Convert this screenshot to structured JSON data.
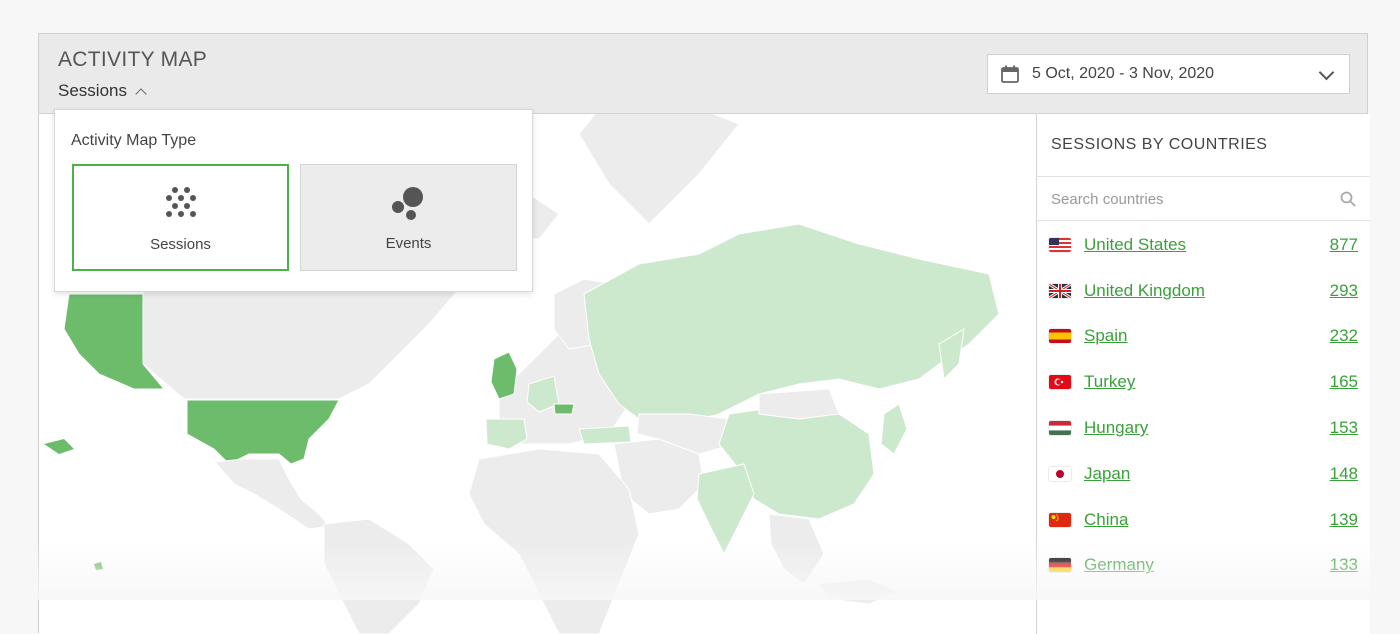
{
  "header": {
    "title": "ACTIVITY MAP",
    "mode_label": "Sessions",
    "date_range": "5 Oct, 2020 - 3 Nov, 2020"
  },
  "popup": {
    "title": "Activity Map Type",
    "options": [
      {
        "label": "Sessions",
        "selected": true,
        "icon": "dots-grid-icon"
      },
      {
        "label": "Events",
        "selected": false,
        "icon": "bubbles-icon"
      }
    ]
  },
  "sidebar": {
    "title": "SESSIONS BY COUNTRIES",
    "search_placeholder": "Search countries",
    "countries": [
      {
        "name": "United States",
        "value": "877",
        "flag": "us-flag-icon"
      },
      {
        "name": "United Kingdom",
        "value": "293",
        "flag": "uk-flag-icon"
      },
      {
        "name": "Spain",
        "value": "232",
        "flag": "spain-flag-icon"
      },
      {
        "name": "Turkey",
        "value": "165",
        "flag": "turkey-flag-icon"
      },
      {
        "name": "Hungary",
        "value": "153",
        "flag": "hungary-flag-icon"
      },
      {
        "name": "Japan",
        "value": "148",
        "flag": "japan-flag-icon"
      },
      {
        "name": "China",
        "value": "139",
        "flag": "china-flag-icon"
      },
      {
        "name": "Germany",
        "value": "133",
        "flag": "germany-flag-icon"
      }
    ]
  },
  "colors": {
    "accent": "#3aa13a",
    "map_high": "#6cbc6c",
    "map_low": "#cde9cd",
    "map_none": "#ececec"
  }
}
